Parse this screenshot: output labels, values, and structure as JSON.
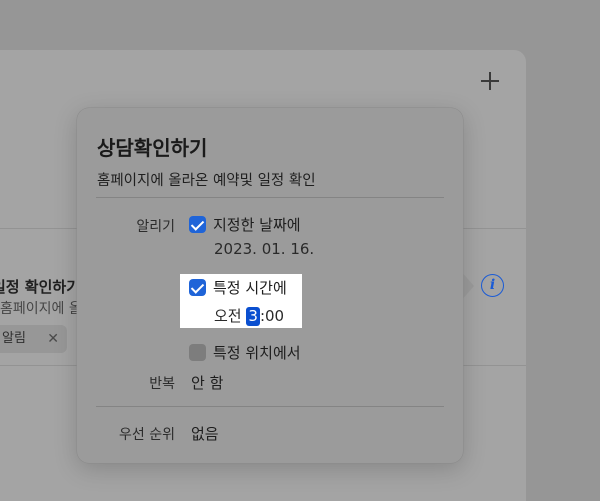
{
  "background": {
    "item_title": "일정 확인하기",
    "item_notes": "홈페이지에 올라온 예약",
    "tag_label": "알림",
    "tag_close": "✕",
    "add_icon": "plus-icon",
    "info_icon": "info-icon",
    "info_glyph": "i"
  },
  "popover": {
    "title": "상담확인하기",
    "notes": "홈페이지에 올라온 예약및 일정 확인",
    "alert_label": "알리기",
    "on_date": {
      "label": "지정한 날짜에",
      "checked": true,
      "value": "2023. 01. 16."
    },
    "on_time": {
      "label": "특정 시간에",
      "checked": true,
      "ampm": "오전",
      "hour": "3",
      "minutes": ":00"
    },
    "at_location": {
      "label": "특정 위치에서",
      "checked": false
    },
    "repeat_label": "반복",
    "repeat_value": "안 함",
    "priority_label": "우선 순위",
    "priority_value": "없음"
  },
  "colors": {
    "accent": "#1f64d8",
    "selection": "#0a4fd0",
    "info": "#1a5bd6"
  }
}
